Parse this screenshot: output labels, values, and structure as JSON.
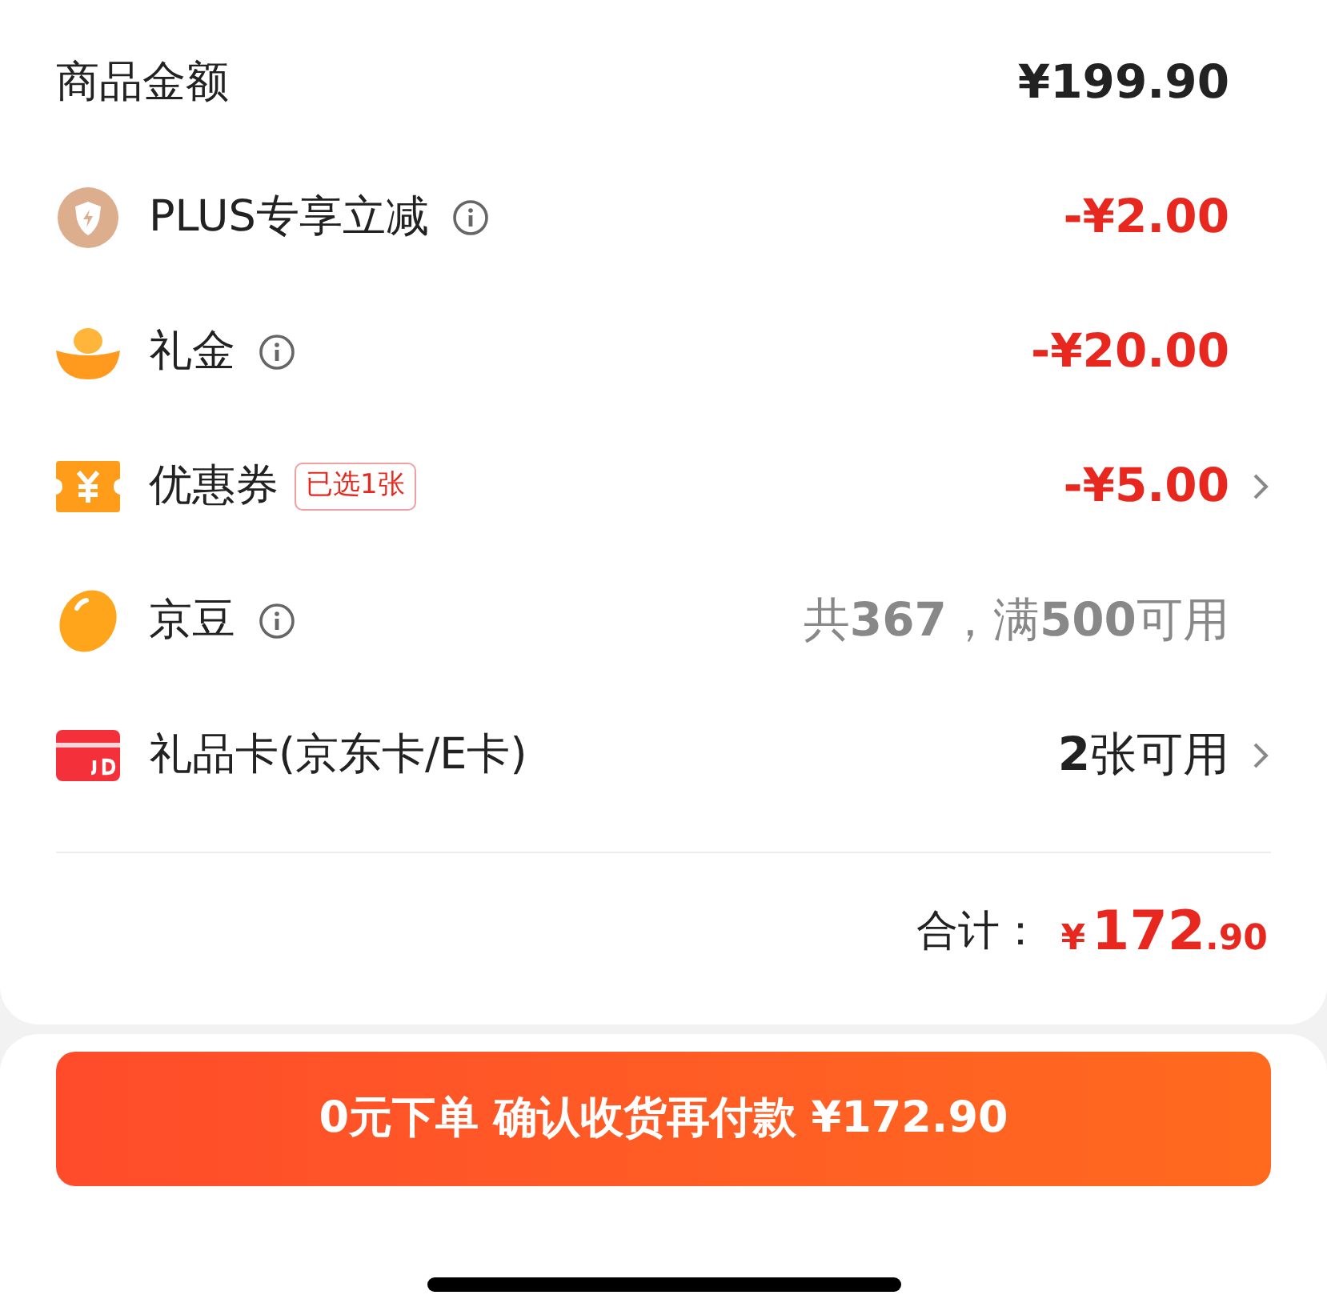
{
  "summary_rows": [
    {
      "label": "商品金额",
      "info": false,
      "value": "¥199.90",
      "kind": "total",
      "chevron": false
    },
    {
      "label": "PLUS专享立减",
      "info": true,
      "value": "-¥2.00",
      "kind": "discount",
      "chevron": false
    },
    {
      "label": "礼金",
      "info": true,
      "value": "-¥20.00",
      "kind": "discount",
      "chevron": false
    },
    {
      "label": "优惠券",
      "info": false,
      "badge": "已选1张",
      "value": "-¥5.00",
      "kind": "discount",
      "chevron": true
    },
    {
      "label": "京豆",
      "info": true,
      "value": "共**367**，满**500**可用",
      "kind": "muted",
      "chevron": false
    },
    {
      "label": "礼品卡(京东卡/E卡)",
      "info": false,
      "value": "**2**张可用",
      "kind": "normal",
      "chevron": true
    }
  ],
  "total": {
    "label": "合计：",
    "currency": "¥",
    "integer": "172",
    "decimal": ".90"
  },
  "submit_button": "0元下单 确认收货再付款 ¥172.90"
}
